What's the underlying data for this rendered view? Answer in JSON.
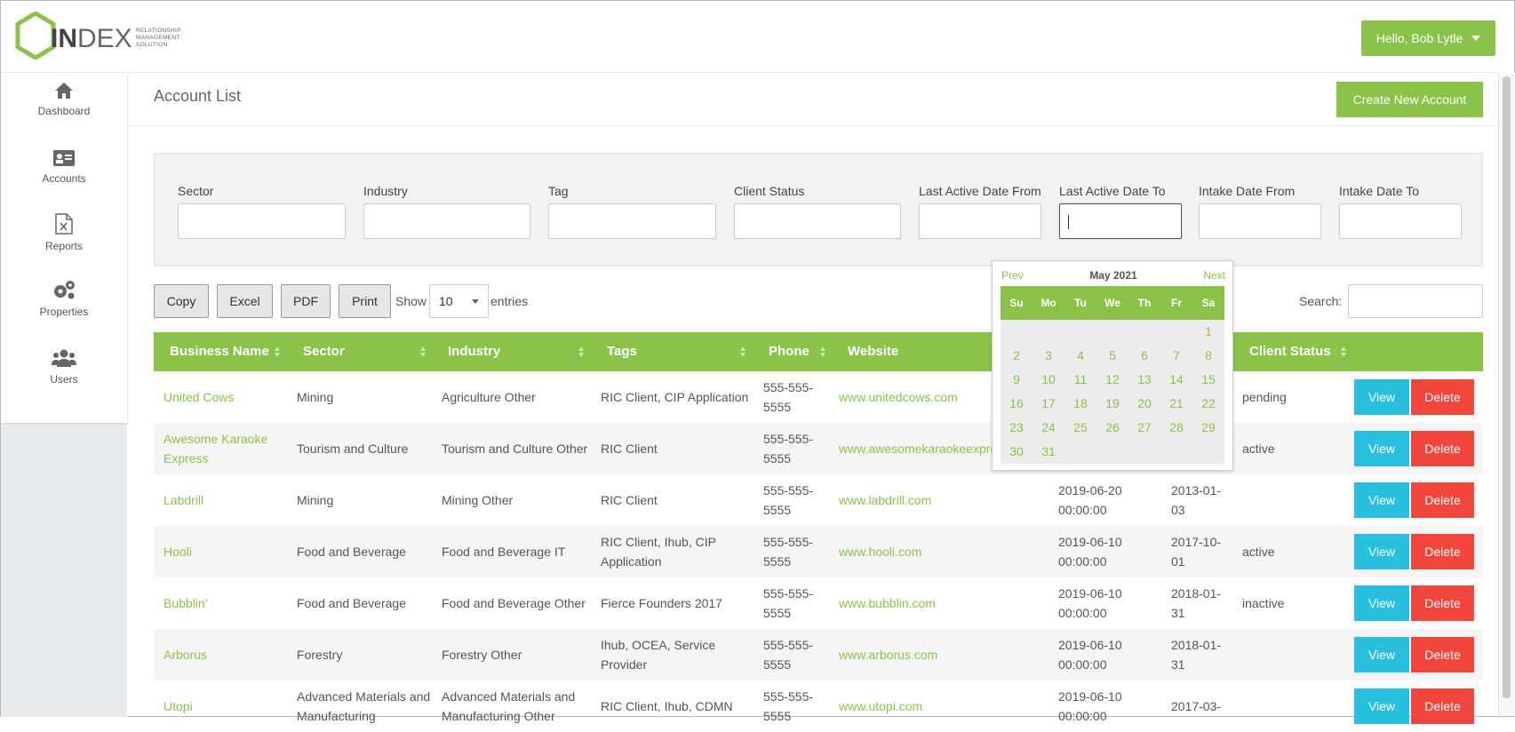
{
  "brand": {
    "logo_main": "IN",
    "logo_thin": "DEX",
    "tagline_lines": [
      "RELATIONSHIP",
      "MANAGEMENT",
      "SOLUTION"
    ],
    "accent_color": "#8bc34a"
  },
  "user_menu": {
    "label": "Hello, Bob Lytle"
  },
  "sidebar": {
    "items": [
      {
        "label": "Dashboard",
        "icon": "home-icon"
      },
      {
        "label": "Accounts",
        "icon": "id-card-icon"
      },
      {
        "label": "Reports",
        "icon": "excel-file-icon"
      },
      {
        "label": "Properties",
        "icon": "gears-icon"
      },
      {
        "label": "Users",
        "icon": "users-icon"
      }
    ]
  },
  "page": {
    "title": "Account List",
    "create_button": "Create New Account"
  },
  "filters": [
    {
      "label": "Sector",
      "value": ""
    },
    {
      "label": "Industry",
      "value": ""
    },
    {
      "label": "Tag",
      "value": ""
    },
    {
      "label": "Client Status",
      "value": ""
    },
    {
      "label": "Last Active Date From",
      "value": ""
    },
    {
      "label": "Last Active Date To",
      "value": ""
    },
    {
      "label": "Intake Date From",
      "value": ""
    },
    {
      "label": "Intake Date To",
      "value": ""
    }
  ],
  "toolbar": {
    "buttons": [
      "Copy",
      "Excel",
      "PDF",
      "Print"
    ],
    "show_label": "Show",
    "entries_value": "10",
    "entries_label": "entries",
    "search_label": "Search:"
  },
  "table": {
    "columns": [
      "Business Name",
      "Sector",
      "Industry",
      "Tags",
      "Phone",
      "Website",
      "Client Status"
    ],
    "view_label": "View",
    "delete_label": "Delete",
    "rows": [
      {
        "name": "United Cows",
        "sector": "Mining",
        "industry": "Agriculture Other",
        "tags": "RIC Client, CIP Application",
        "phone": "555-555-5555",
        "website": "www.unitedcows.com",
        "last_active": "",
        "intake": "",
        "status": "pending"
      },
      {
        "name": "Awesome Karaoke Express",
        "sector": "Tourism and Culture",
        "industry": "Tourism and Culture Other",
        "tags": "RIC Client",
        "phone": "555-555-5555",
        "website": "www.awesomekaraokeexpre",
        "last_active": "",
        "intake": "",
        "status": "active"
      },
      {
        "name": "Labdrill",
        "sector": "Mining",
        "industry": "Mining Other",
        "tags": "RIC Client",
        "phone": "555-555-5555",
        "website": "www.labdrill.com",
        "last_active": "2019-06-20 00:00:00",
        "intake": "2013-01-03",
        "status": ""
      },
      {
        "name": "Hooli",
        "sector": "Food and Beverage",
        "industry": "Food and Beverage IT",
        "tags": "RIC Client, Ihub, CIP Application",
        "phone": "555-555-5555",
        "website": "www.hooli.com",
        "last_active": "2019-06-10 00:00:00",
        "intake": "2017-10-01",
        "status": "active"
      },
      {
        "name": "Bubblin'",
        "sector": "Food and Beverage",
        "industry": "Food and Beverage Other",
        "tags": "Fierce Founders 2017",
        "phone": "555-555-5555",
        "website": "www.bubblin.com",
        "last_active": "2019-06-10 00:00:00",
        "intake": "2018-01-31",
        "status": "inactive"
      },
      {
        "name": "Arborus",
        "sector": "Forestry",
        "industry": "Forestry Other",
        "tags": "Ihub, OCEA, Service Provider",
        "phone": "555-555-5555",
        "website": "www.arborus.com",
        "last_active": "2019-06-10 00:00:00",
        "intake": "2018-01-31",
        "status": ""
      },
      {
        "name": "Utopi",
        "sector": "Advanced Materials and Manufacturing",
        "industry": "Advanced Materials and Manufacturing Other",
        "tags": "RIC Client, Ihub, CDMN",
        "phone": "555-555-5555",
        "website": "www.utopi.com",
        "last_active": "2019-06-10 00:00:00",
        "intake": "2017-03-",
        "status": ""
      }
    ]
  },
  "datepicker": {
    "prev": "Prev",
    "next": "Next",
    "title": "May 2021",
    "weekdays": [
      "Su",
      "Mo",
      "Tu",
      "We",
      "Th",
      "Fr",
      "Sa"
    ],
    "weeks": [
      [
        "",
        "",
        "",
        "",
        "",
        "",
        "1"
      ],
      [
        "2",
        "3",
        "4",
        "5",
        "6",
        "7",
        "8"
      ],
      [
        "9",
        "10",
        "11",
        "12",
        "13",
        "14",
        "15"
      ],
      [
        "16",
        "17",
        "18",
        "19",
        "20",
        "21",
        "22"
      ],
      [
        "23",
        "24",
        "25",
        "26",
        "27",
        "28",
        "29"
      ],
      [
        "30",
        "31",
        "",
        "",
        "",
        "",
        ""
      ]
    ]
  }
}
